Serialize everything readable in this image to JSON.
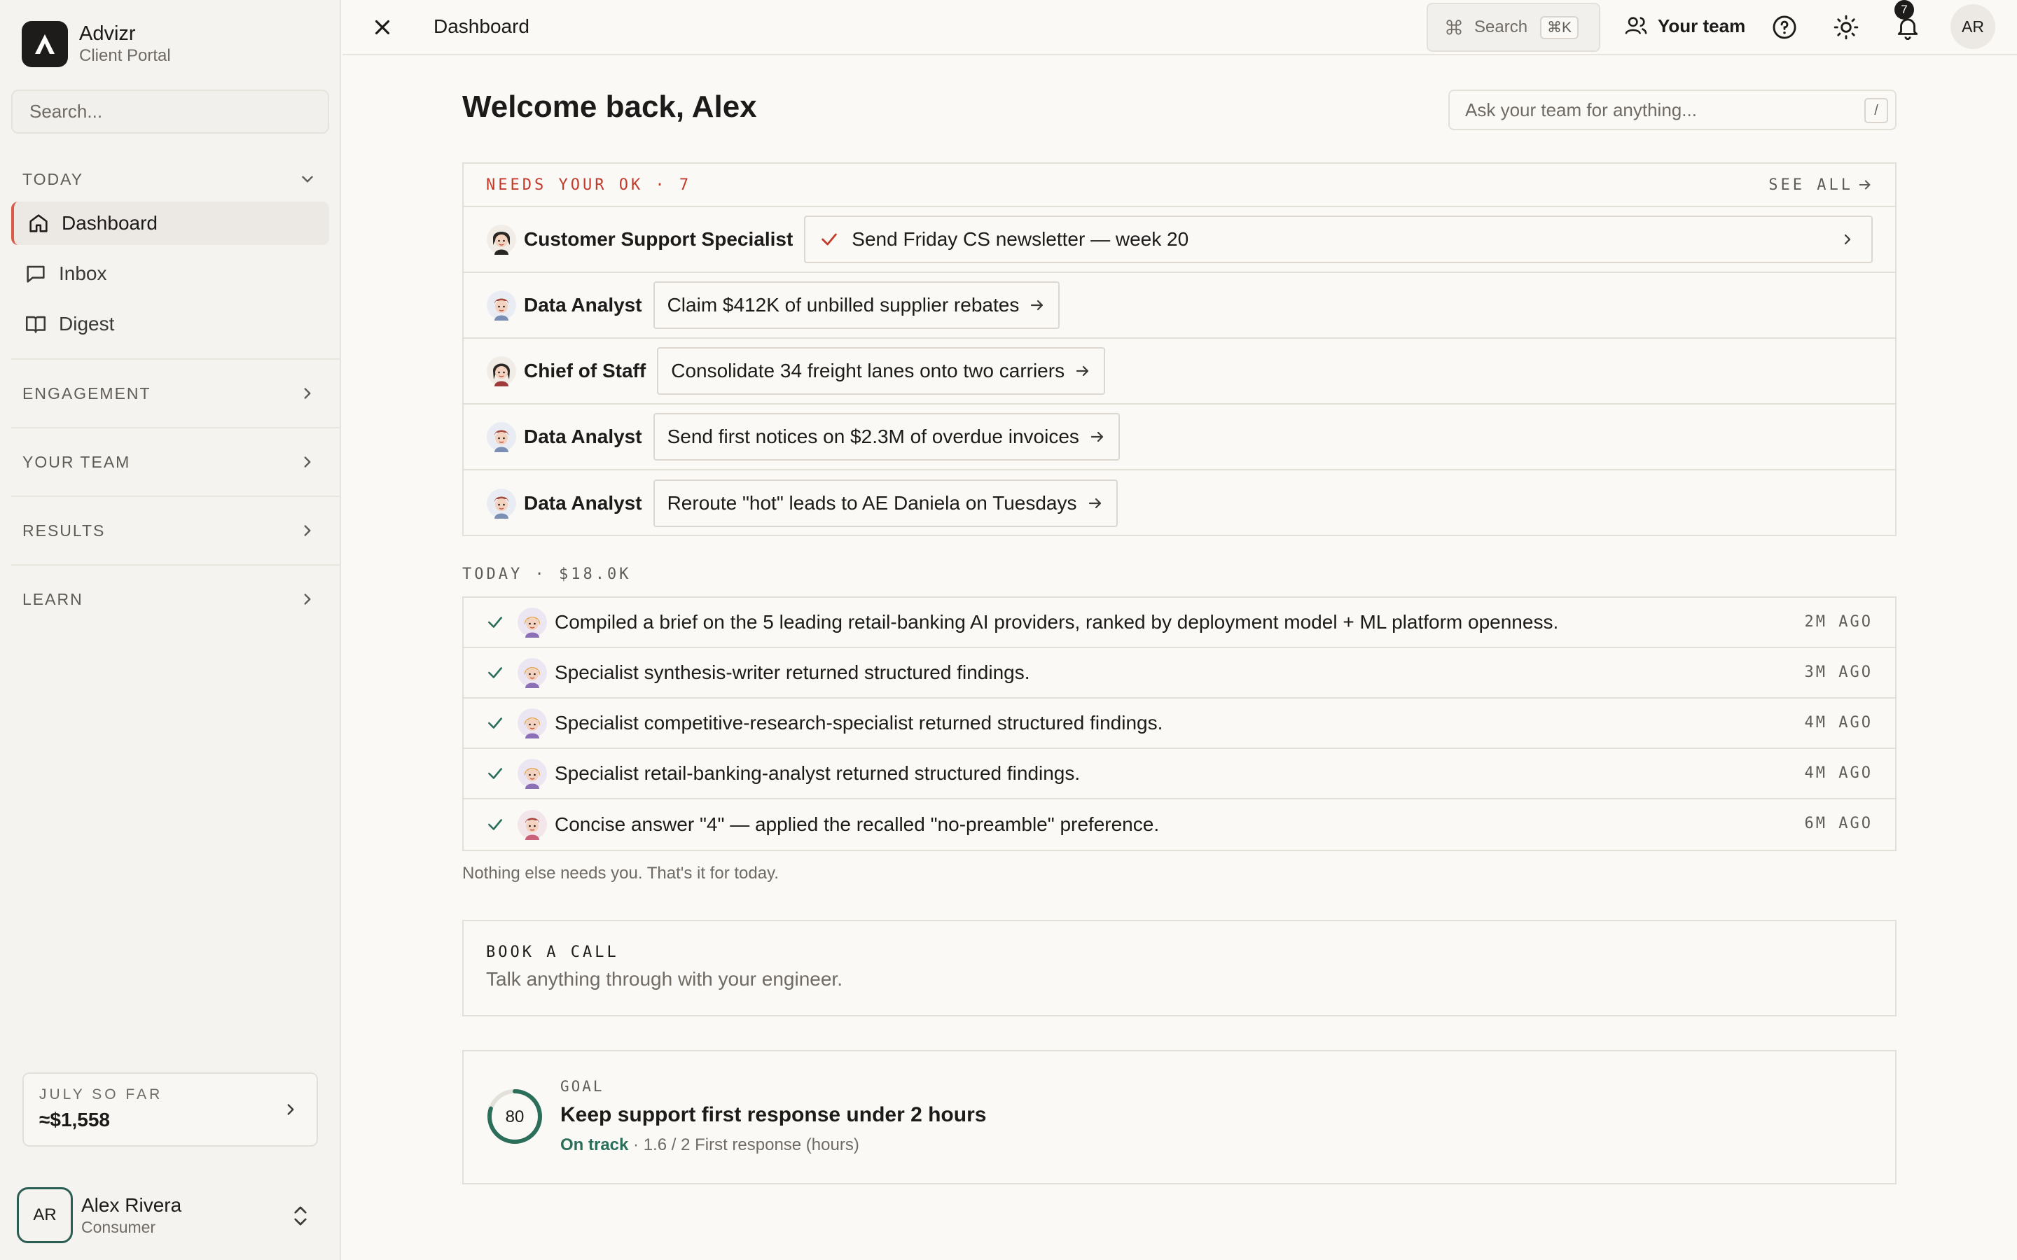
{
  "app": {
    "name": "Advizr",
    "subtitle": "Client Portal"
  },
  "sidebar": {
    "search_placeholder": "Search...",
    "sections": {
      "today": "TODAY",
      "engagement": "ENGAGEMENT",
      "your_team": "YOUR TEAM",
      "results": "RESULTS",
      "learn": "LEARN"
    },
    "items": [
      {
        "label": "Dashboard",
        "icon": "home-icon",
        "active": true
      },
      {
        "label": "Inbox",
        "icon": "chat-icon",
        "active": false
      },
      {
        "label": "Digest",
        "icon": "book-icon",
        "active": false
      }
    ],
    "spend": {
      "label": "JULY SO FAR",
      "value": "≈$1,558"
    },
    "user": {
      "initials": "AR",
      "name": "Alex Rivera",
      "role": "Consumer"
    }
  },
  "topbar": {
    "title": "Dashboard",
    "search_label": "Search",
    "search_shortcut": "⌘K",
    "team_label": "Your team",
    "notification_count": "7",
    "avatar_initials": "AR"
  },
  "main": {
    "welcome": "Welcome back, Alex",
    "ask_placeholder": "Ask your team for anything...",
    "ask_shortcut": "/",
    "needs_ok": {
      "label": "NEEDS YOUR OK · 7",
      "see_all": "SEE ALL",
      "rows": [
        {
          "role": "Customer Support Specialist",
          "task": "Send Friday CS newsletter — week 20"
        },
        {
          "role": "Data Analyst",
          "task": "Claim $412K of unbilled supplier rebates"
        },
        {
          "role": "Chief of Staff",
          "task": "Consolidate 34 freight lanes onto two carriers"
        },
        {
          "role": "Data Analyst",
          "task": "Send first notices on $2.3M of overdue invoices"
        },
        {
          "role": "Data Analyst",
          "task": "Reroute \"hot\" leads to AE Daniela on Tuesdays"
        }
      ]
    },
    "today": {
      "label": "TODAY · $18.0K",
      "rows": [
        {
          "text": "Compiled a brief on the 5 leading retail-banking AI providers, ranked by deployment model + ML platform openness.",
          "time": "2M AGO"
        },
        {
          "text": "Specialist synthesis-writer returned structured findings.",
          "time": "3M AGO"
        },
        {
          "text": "Specialist competitive-research-specialist returned structured findings.",
          "time": "4M AGO"
        },
        {
          "text": "Specialist retail-banking-analyst returned structured findings.",
          "time": "4M AGO"
        },
        {
          "text": "Concise answer \"4\" — applied the recalled \"no-preamble\" preference.",
          "time": "6M AGO"
        }
      ],
      "footer": "Nothing else needs you. That's it for today."
    },
    "book_call": {
      "label": "BOOK A CALL",
      "subtitle": "Talk anything through with your engineer."
    },
    "goal": {
      "label": "GOAL",
      "progress": 80,
      "title": "Keep support first response under 2 hours",
      "status": "On track",
      "detail": " · 1.6 / 2 First response (hours)"
    }
  },
  "colors": {
    "accent_red": "#c23b2a",
    "accent_green": "#2b6e5a",
    "dark": "#1d1c1a"
  }
}
